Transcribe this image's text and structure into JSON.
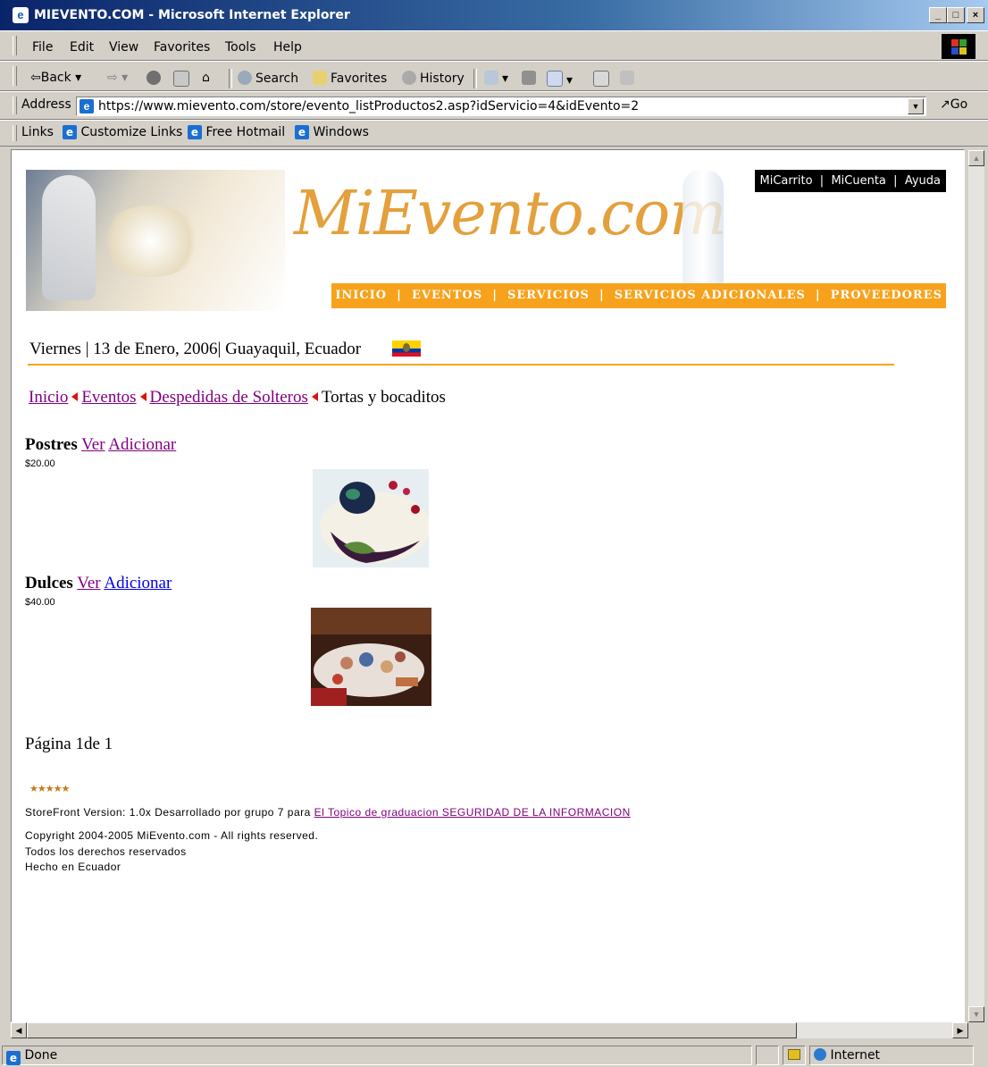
{
  "window": {
    "title": "MIEVENTO.COM - Microsoft Internet Explorer",
    "controls": {
      "minimize": "_",
      "maximize": "□",
      "close": "×"
    }
  },
  "menu": [
    "File",
    "Edit",
    "View",
    "Favorites",
    "Tools",
    "Help"
  ],
  "toolbar": {
    "back": "Back",
    "search": "Search",
    "favorites": "Favorites",
    "history": "History"
  },
  "address": {
    "label": "Address",
    "url": "https://www.mievento.com/store/evento_listProductos2.asp?idServicio=4&idEvento=2",
    "go": "Go"
  },
  "links": {
    "label": "Links",
    "items": [
      "Customize Links",
      "Free Hotmail",
      "Windows"
    ]
  },
  "site": {
    "logo_text": "MiEvento.com",
    "top_nav": [
      "MiCarrito",
      "MiCuenta",
      "Ayuda"
    ],
    "main_nav": [
      "INICIO",
      "EVENTOS",
      "SERVICIOS",
      "SERVICIOS ADICIONALES",
      "PROVEEDORES"
    ],
    "date_line": "Viernes | 13 de Enero, 2006| Guayaquil, Ecuador",
    "breadcrumb": [
      "Inicio",
      "Eventos",
      "Despedidas de Solteros"
    ],
    "breadcrumb_current": "Tortas y bocaditos",
    "products": [
      {
        "name": "Postres",
        "view": "Ver",
        "add": "Adicionar",
        "price": "$20.00"
      },
      {
        "name": "Dulces",
        "view": "Ver",
        "add": "Adicionar",
        "price": "$40.00"
      }
    ],
    "pager": "Página 1de 1",
    "footer": {
      "stars": "★★★★★",
      "storefront_prefix": "StoreFront Version: 1.0x Desarrollado por grupo 7 para",
      "storefront_link": "El Topico de graduacion SEGURIDAD DE LA INFORMACION",
      "copyright": "Copyright 2004-2005 MiEvento.com - All rights reserved.",
      "rights": "Todos los derechos reservados",
      "made_in": "Hecho en Ecuador"
    }
  },
  "status": {
    "text": "Done",
    "zone": "Internet"
  }
}
